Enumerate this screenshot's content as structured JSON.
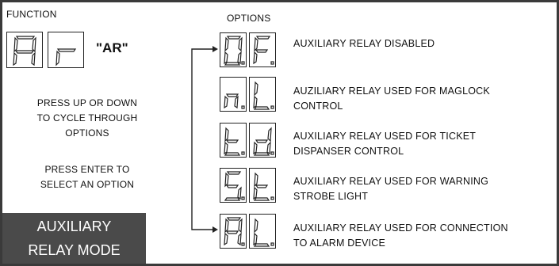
{
  "function": {
    "label": "FUNCTION",
    "code_display": [
      "A",
      "r"
    ],
    "code_name": "\"AR\""
  },
  "instructions": {
    "cycle_lines": [
      "PRESS UP OR DOWN",
      "TO CYCLE THROUGH",
      "OPTIONS"
    ],
    "enter_lines": [
      "PRESS ENTER TO",
      "SELECT AN OPTION"
    ]
  },
  "mode_title": [
    "AUXILIARY",
    "RELAY MODE"
  ],
  "options": {
    "label": "OPTIONS",
    "items": [
      {
        "display": [
          "0.",
          "F."
        ],
        "description": [
          "AUXILIARY RELAY DISABLED"
        ]
      },
      {
        "display": [
          "n.",
          "L."
        ],
        "description": [
          "AUZILIARY RELAY USED FOR MAGLOCK",
          "CONTROL"
        ]
      },
      {
        "display": [
          "t.",
          "d."
        ],
        "description": [
          "AUXILIARY RELAY USED FOR TICKET",
          "DISPANSER CONTROL"
        ]
      },
      {
        "display": [
          "S.",
          "t."
        ],
        "description": [
          "AUXILIARY RELAY USED FOR WARNING",
          "STROBE LIGHT"
        ]
      },
      {
        "display": [
          "A.",
          "L."
        ],
        "description": [
          "AUXILIARY RELAY USED FOR CONNECTION",
          "TO ALARM DEVICE"
        ]
      }
    ]
  }
}
